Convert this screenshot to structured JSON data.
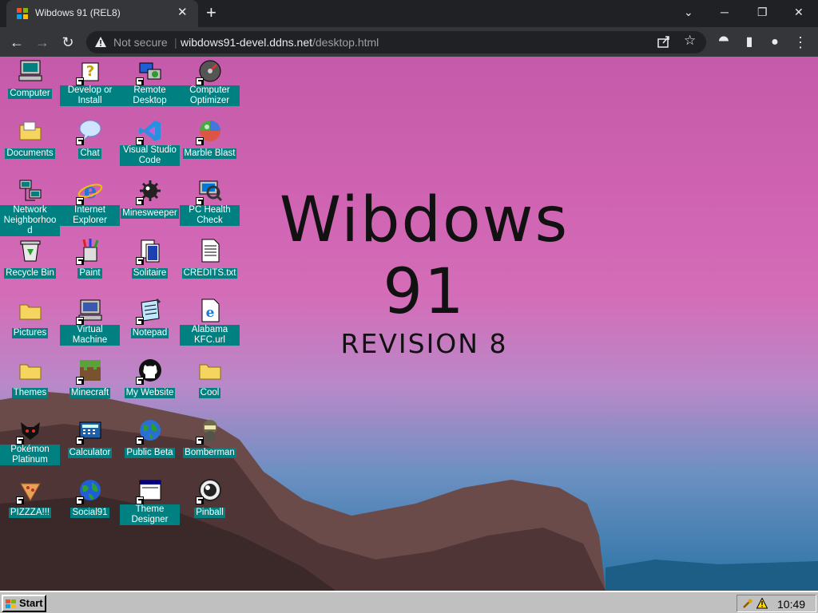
{
  "browser": {
    "tab_title": "Wibdows 91 (REL8)",
    "tab_close": "✕",
    "new_tab": "+",
    "window_controls": {
      "min": "─",
      "max": "❐",
      "close": "✕",
      "chevron": "⌄"
    },
    "nav": {
      "back": "←",
      "forward": "→",
      "reload": "↻",
      "extensions": "⯊",
      "sidebar": "▮",
      "profile": "●",
      "menu": "⋮"
    },
    "security_label": "Not secure",
    "url_host": "wibdows91-devel.ddns.net",
    "url_path": "/desktop.html",
    "bookmark_star": "☆"
  },
  "desktop": {
    "title": "Wibdows 91",
    "subtitle": "REVISION 8",
    "icons": [
      {
        "label": "Computer",
        "icon": "computer-icon",
        "shortcut": false
      },
      {
        "label": "Develop or Install",
        "icon": "help-icon",
        "shortcut": true
      },
      {
        "label": "Remote Desktop",
        "icon": "remote-desktop-icon",
        "shortcut": true
      },
      {
        "label": "Computer Optimizer",
        "icon": "optimizer-icon",
        "shortcut": true
      },
      {
        "label": "Documents",
        "icon": "documents-folder-icon",
        "shortcut": false
      },
      {
        "label": "Chat",
        "icon": "chat-icon",
        "shortcut": true
      },
      {
        "label": "Visual Studio Code",
        "icon": "vscode-icon",
        "shortcut": true
      },
      {
        "label": "Marble Blast",
        "icon": "marble-icon",
        "shortcut": true
      },
      {
        "label": "Network Neighborhood",
        "icon": "network-icon",
        "shortcut": false
      },
      {
        "label": "Internet Explorer",
        "icon": "ie-icon",
        "shortcut": true
      },
      {
        "label": "Minesweeper",
        "icon": "mine-icon",
        "shortcut": true
      },
      {
        "label": "PC Health Check",
        "icon": "health-check-icon",
        "shortcut": true
      },
      {
        "label": "Recycle Bin",
        "icon": "recycle-bin-icon",
        "shortcut": false
      },
      {
        "label": "Paint",
        "icon": "paint-icon",
        "shortcut": true
      },
      {
        "label": "Solitaire",
        "icon": "solitaire-icon",
        "shortcut": true
      },
      {
        "label": "CREDITS.txt",
        "icon": "text-file-icon",
        "shortcut": false
      },
      {
        "label": "Pictures",
        "icon": "pictures-folder-icon",
        "shortcut": false
      },
      {
        "label": "Virtual Machine",
        "icon": "virtual-machine-icon",
        "shortcut": true
      },
      {
        "label": "Notepad",
        "icon": "notepad-icon",
        "shortcut": true
      },
      {
        "label": "Alabama KFC.url",
        "icon": "url-file-icon",
        "shortcut": false
      },
      {
        "label": "Themes",
        "icon": "themes-folder-icon",
        "shortcut": false
      },
      {
        "label": "Minecraft",
        "icon": "minecraft-icon",
        "shortcut": true
      },
      {
        "label": "My Website",
        "icon": "github-icon",
        "shortcut": true
      },
      {
        "label": "Cool",
        "icon": "cool-folder-icon",
        "shortcut": false
      },
      {
        "label": "Pokémon Platinum",
        "icon": "pokemon-icon",
        "shortcut": true
      },
      {
        "label": "Calculator",
        "icon": "calculator-icon",
        "shortcut": true
      },
      {
        "label": "Public Beta",
        "icon": "globe-icon",
        "shortcut": true
      },
      {
        "label": "Bomberman",
        "icon": "bomberman-icon",
        "shortcut": true
      },
      {
        "label": "PIZZZA!!!",
        "icon": "pizza-icon",
        "shortcut": true
      },
      {
        "label": "Social91",
        "icon": "social-globe-icon",
        "shortcut": true
      },
      {
        "label": "Theme Designer",
        "icon": "theme-designer-icon",
        "shortcut": true
      },
      {
        "label": "Pinball",
        "icon": "pinball-icon",
        "shortcut": true
      }
    ]
  },
  "taskbar": {
    "start_label": "Start",
    "clock": "10:49"
  },
  "colors": {
    "label_bg": "#008080",
    "taskbar": "#c0c0c0",
    "chrome_dark": "#202124",
    "chrome_mid": "#35363a"
  }
}
